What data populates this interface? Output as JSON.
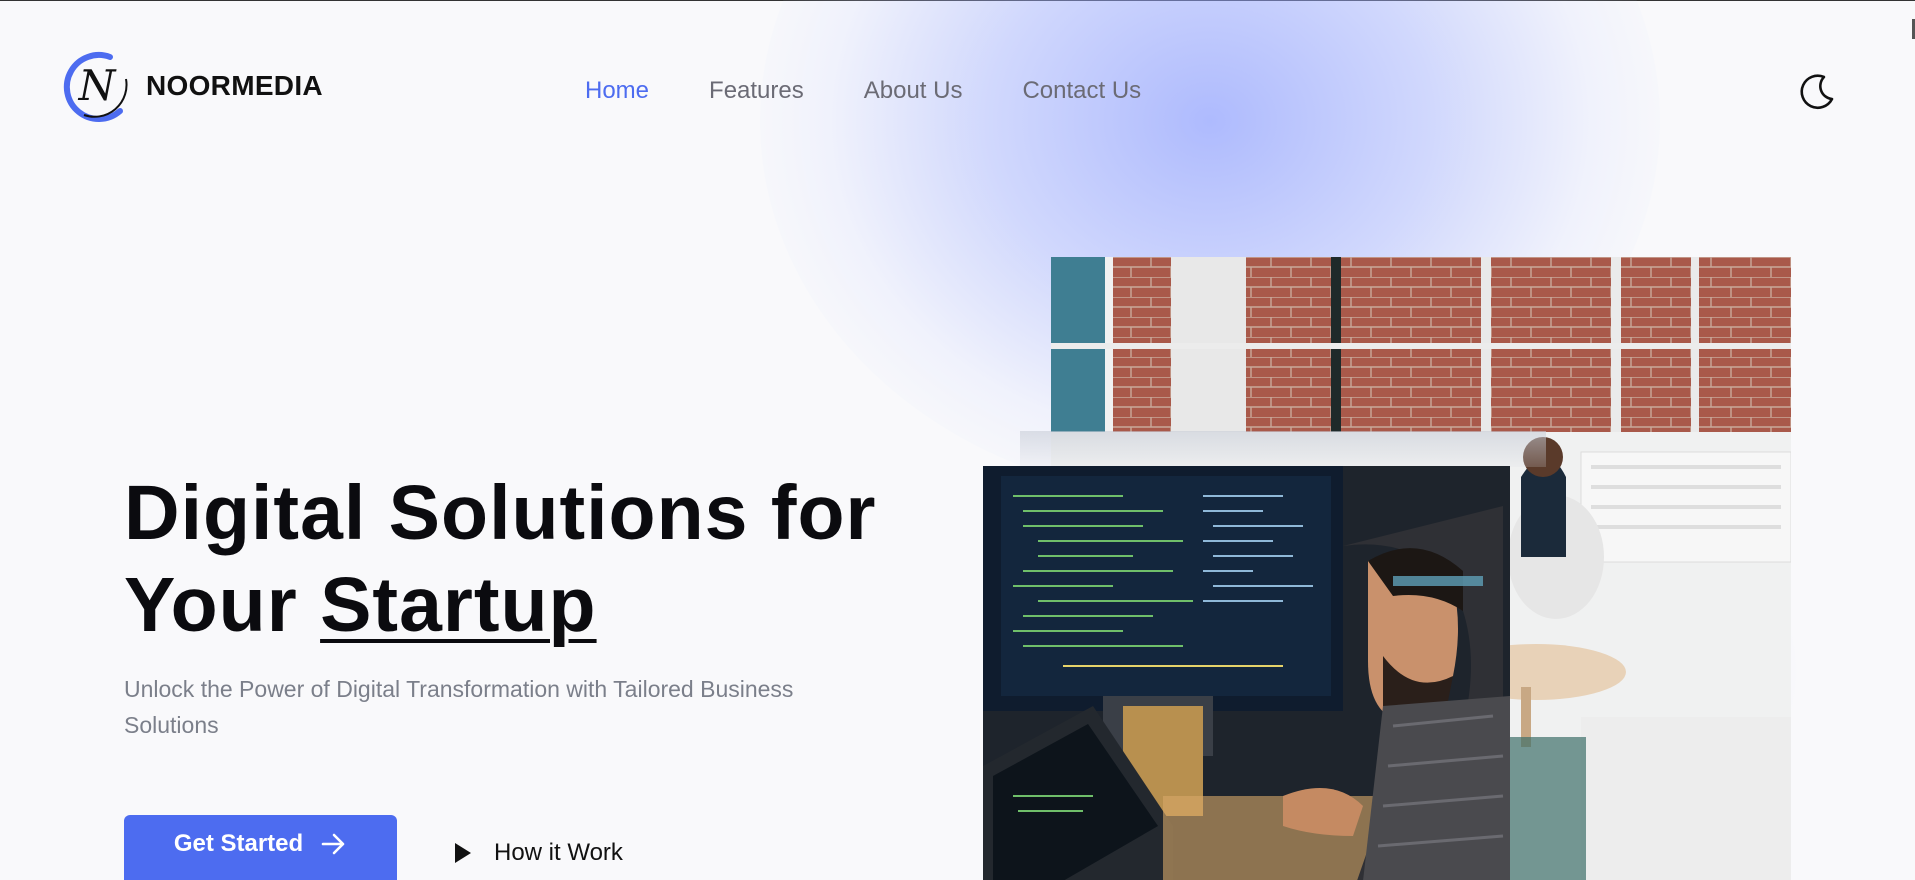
{
  "brand": {
    "name": "NOORMEDIA",
    "logo_letter": "N",
    "accent": "#4d6cf0"
  },
  "nav": {
    "items": [
      {
        "label": "Home",
        "active": true
      },
      {
        "label": "Features",
        "active": false
      },
      {
        "label": "About Us",
        "active": false
      },
      {
        "label": "Contact Us",
        "active": false
      }
    ]
  },
  "theme_toggle": {
    "icon": "moon-icon"
  },
  "hero": {
    "title_line1": "Digital Solutions for",
    "title_line2_prefix": "Your ",
    "title_line2_highlight": "Startup",
    "subtitle": "Unlock the Power of Digital Transformation with Tailored Business Solutions",
    "primary_cta": "Get Started",
    "secondary_cta": "How it Work"
  },
  "colors": {
    "primary": "#4d6cf0",
    "nav_text": "#6b6b75",
    "subtitle": "#7b7f8a"
  }
}
